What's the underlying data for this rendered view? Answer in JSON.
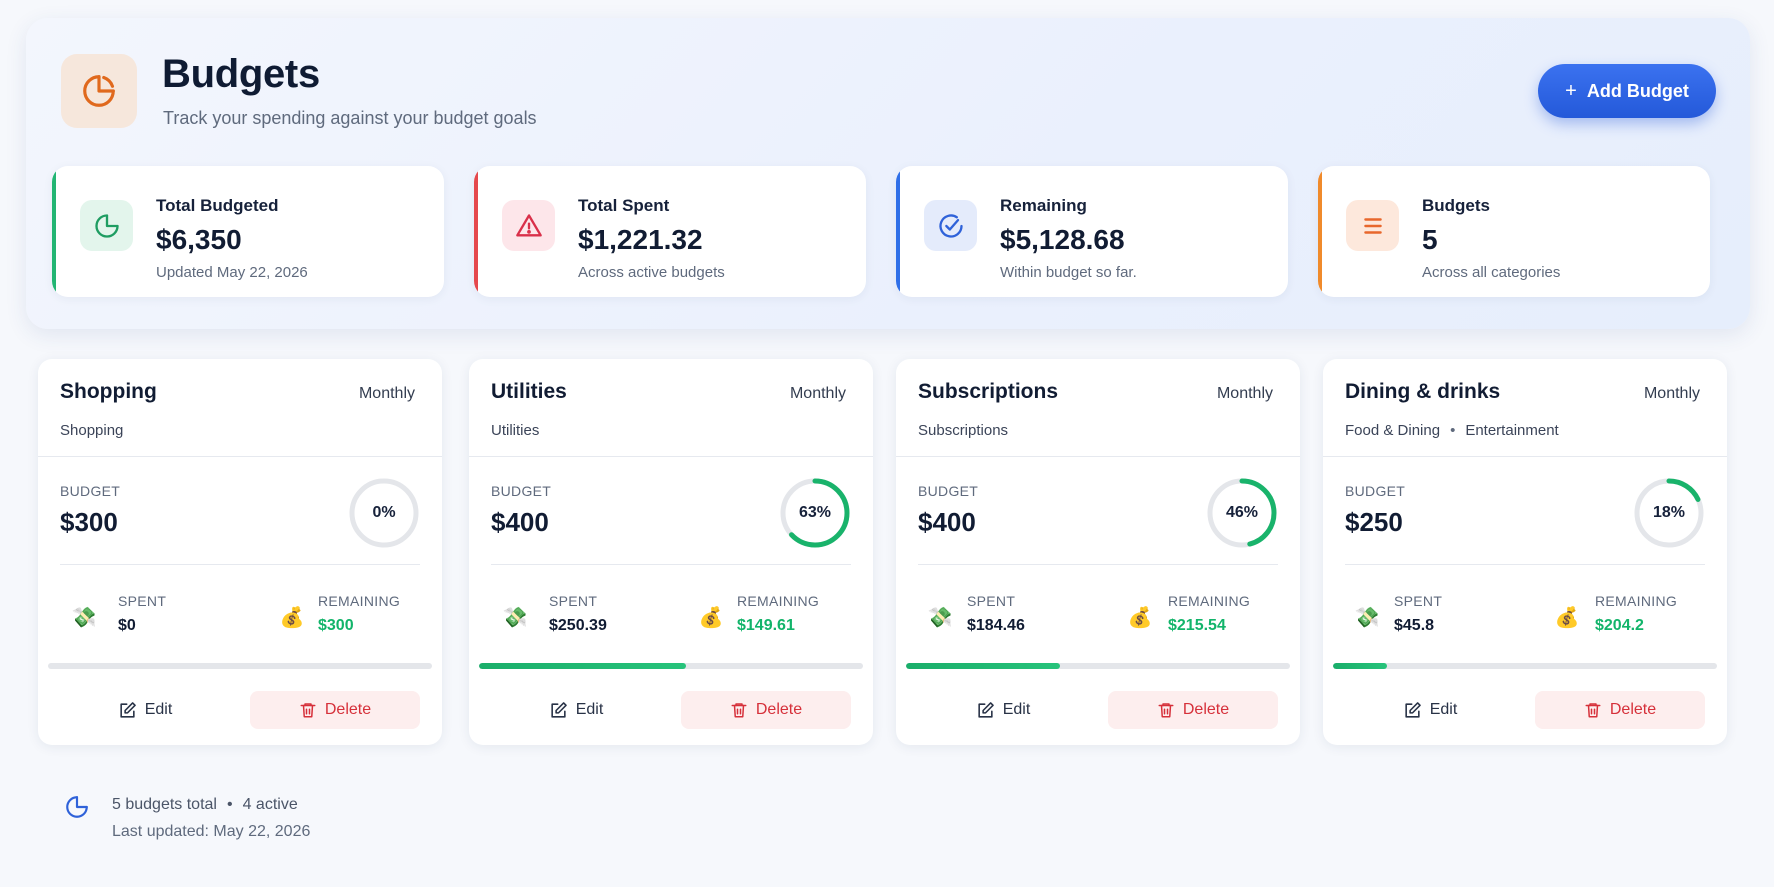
{
  "header": {
    "title": "Budgets",
    "subtitle": "Track your spending against your budget goals",
    "add_button_label": "Add Budget",
    "add_button_icon": "plus-icon"
  },
  "stats": [
    {
      "label": "Total Budgeted",
      "value": "$6,350",
      "note": "Updated May 22, 2026",
      "icon": "pie-chart-icon",
      "accent": "#22b573",
      "icon_bg": "#e3f5ec",
      "icon_color": "#1f9d62"
    },
    {
      "label": "Total Spent",
      "value": "$1,221.32",
      "note": "Across active budgets",
      "icon": "warning-icon",
      "accent": "#e5484d",
      "icon_bg": "#fde6ea",
      "icon_color": "#d9304a"
    },
    {
      "label": "Remaining",
      "value": "$5,128.68",
      "note": "Within budget so far.",
      "icon": "check-circle-icon",
      "accent": "#2f6fe8",
      "icon_bg": "#e4ebfb",
      "icon_color": "#2f62d9"
    },
    {
      "label": "Budgets",
      "value": "5",
      "note": "Across all categories",
      "icon": "list-icon",
      "accent": "#f08a2b",
      "icon_bg": "#fde8dc",
      "icon_color": "#e8672c"
    }
  ],
  "budget_label": "BUDGET",
  "spent_label": "SPENT",
  "remaining_label": "REMAINING",
  "edit_label": "Edit",
  "delete_label": "Delete",
  "budgets": [
    {
      "name": "Shopping",
      "period": "Monthly",
      "categories": [
        "Shopping"
      ],
      "budget": "$300",
      "percent_label": "0%",
      "percent": 0,
      "spent": "$0",
      "remaining": "$300",
      "spent_fraction": 0
    },
    {
      "name": "Utilities",
      "period": "Monthly",
      "categories": [
        "Utilities"
      ],
      "budget": "$400",
      "percent_label": "63%",
      "percent": 63,
      "spent": "$250.39",
      "remaining": "$149.61",
      "spent_fraction": 0.54
    },
    {
      "name": "Subscriptions",
      "period": "Monthly",
      "categories": [
        "Subscriptions"
      ],
      "budget": "$400",
      "percent_label": "46%",
      "percent": 46,
      "spent": "$184.46",
      "remaining": "$215.54",
      "spent_fraction": 0.4
    },
    {
      "name": "Dining & drinks",
      "period": "Monthly",
      "categories": [
        "Food & Dining",
        "Entertainment"
      ],
      "budget": "$250",
      "percent_label": "18%",
      "percent": 18,
      "spent": "$45.8",
      "remaining": "$204.2",
      "spent_fraction": 0.14
    }
  ],
  "footer": {
    "total": "5 budgets total",
    "active": "4 active",
    "last_updated": "Last updated: May 22, 2026",
    "icon": "pie-chart-icon"
  },
  "colors": {
    "accent": "#2459d9",
    "green": "#12b46a",
    "danger": "#d6303a"
  }
}
